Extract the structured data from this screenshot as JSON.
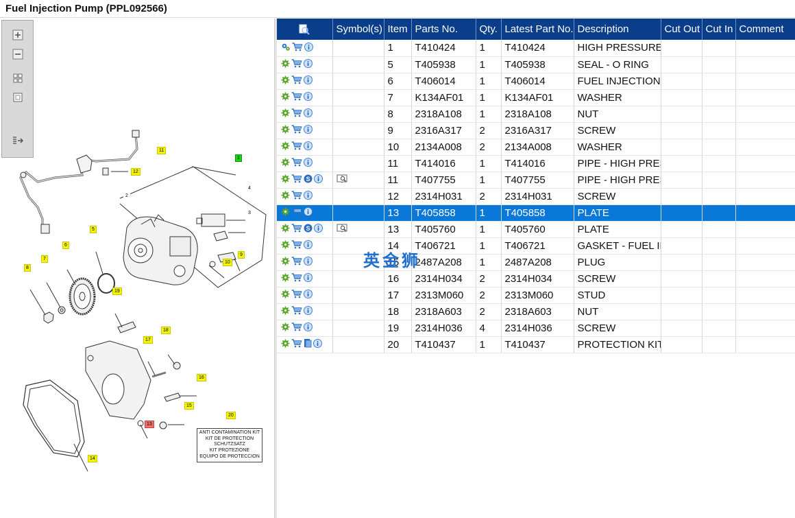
{
  "window": {
    "title": "Fuel Injection Pump (PPL092566)"
  },
  "toolbox": {
    "zoom_in": "zoom-in-icon",
    "zoom_out": "zoom-out-icon",
    "fit_all": "fit-all-icon",
    "fit_page": "fit-page-icon",
    "export": "export-icon"
  },
  "diagram": {
    "callouts": [
      "1",
      "2",
      "3",
      "4",
      "5",
      "6",
      "7",
      "8",
      "9",
      "10",
      "11",
      "12",
      "13",
      "14",
      "15",
      "16",
      "17",
      "18",
      "19",
      "20"
    ],
    "kit_box_lines": [
      "ANTI CONTAMINATION KIT",
      "KIT DE PROTECTION",
      "SCHUTZSATZ",
      "KIT PROTEZIONE",
      "EQUIPO DE PROTECCION"
    ]
  },
  "table": {
    "columns": [
      "",
      "Symbol(s)",
      "Item",
      "Parts No.",
      "Qty.",
      "Latest Part No.",
      "Description",
      "Cut Out",
      "Cut In",
      "Comment"
    ],
    "rows": [
      {
        "item": "1",
        "part": "T410424",
        "qty": "1",
        "latest": "T410424",
        "desc": "HIGH PRESSURE FUEL PUMP",
        "icons": [
          "gears-icon",
          "cart-icon",
          "info-icon"
        ],
        "symbols": ""
      },
      {
        "item": "5",
        "part": "T405938",
        "qty": "1",
        "latest": "T405938",
        "desc": "SEAL - O RING",
        "icons": [
          "gear-icon",
          "cart-icon",
          "info-icon"
        ],
        "symbols": ""
      },
      {
        "item": "6",
        "part": "T406014",
        "qty": "1",
        "latest": "T406014",
        "desc": "FUEL INJECTION PUMP GEAR",
        "icons": [
          "gear-icon",
          "cart-icon",
          "info-icon"
        ],
        "symbols": ""
      },
      {
        "item": "7",
        "part": "K134AF01",
        "qty": "1",
        "latest": "K134AF01",
        "desc": "WASHER",
        "icons": [
          "gear-icon",
          "cart-icon",
          "info-icon"
        ],
        "symbols": ""
      },
      {
        "item": "8",
        "part": "2318A108",
        "qty": "1",
        "latest": "2318A108",
        "desc": "NUT",
        "icons": [
          "gear-icon",
          "cart-icon",
          "info-icon"
        ],
        "symbols": ""
      },
      {
        "item": "9",
        "part": "2316A317",
        "qty": "2",
        "latest": "2316A317",
        "desc": "SCREW",
        "icons": [
          "gear-icon",
          "cart-icon",
          "info-icon"
        ],
        "symbols": ""
      },
      {
        "item": "10",
        "part": "2134A008",
        "qty": "2",
        "latest": "2134A008",
        "desc": "WASHER",
        "icons": [
          "gear-icon",
          "cart-icon",
          "info-icon"
        ],
        "symbols": ""
      },
      {
        "item": "11",
        "part": "T414016",
        "qty": "1",
        "latest": "T414016",
        "desc": "PIPE - HIGH PRESSURE",
        "icons": [
          "gear-icon",
          "cart-icon",
          "info-icon"
        ],
        "symbols": ""
      },
      {
        "item": "11",
        "part": "T407755",
        "qty": "1",
        "latest": "T407755",
        "desc": "PIPE - HIGH PRESSURE",
        "icons": [
          "gear-icon",
          "cart-icon",
          "s-badge-icon",
          "info-icon"
        ],
        "symbols": "book-icon"
      },
      {
        "item": "12",
        "part": "2314H031",
        "qty": "2",
        "latest": "2314H031",
        "desc": "SCREW",
        "icons": [
          "gear-icon",
          "cart-icon",
          "info-icon"
        ],
        "symbols": ""
      },
      {
        "item": "13",
        "part": "T405858",
        "qty": "1",
        "latest": "T405858",
        "desc": "PLATE",
        "icons": [
          "gear-icon",
          "cart-icon",
          "info-icon"
        ],
        "symbols": "",
        "selected": true
      },
      {
        "item": "13",
        "part": "T405760",
        "qty": "1",
        "latest": "T405760",
        "desc": "PLATE",
        "icons": [
          "gear-icon",
          "cart-icon",
          "s-badge-icon",
          "info-icon"
        ],
        "symbols": "book-icon"
      },
      {
        "item": "14",
        "part": "T406721",
        "qty": "1",
        "latest": "T406721",
        "desc": "GASKET - FUEL INJECTION PUMP",
        "icons": [
          "gear-icon",
          "cart-icon",
          "info-icon"
        ],
        "symbols": ""
      },
      {
        "item": "15",
        "part": "2487A208",
        "qty": "1",
        "latest": "2487A208",
        "desc": "PLUG",
        "icons": [
          "gear-icon",
          "cart-icon",
          "info-icon"
        ],
        "symbols": ""
      },
      {
        "item": "16",
        "part": "2314H034",
        "qty": "2",
        "latest": "2314H034",
        "desc": "SCREW",
        "icons": [
          "gear-icon",
          "cart-icon",
          "info-icon"
        ],
        "symbols": ""
      },
      {
        "item": "17",
        "part": "2313M060",
        "qty": "2",
        "latest": "2313M060",
        "desc": "STUD",
        "icons": [
          "gear-icon",
          "cart-icon",
          "info-icon"
        ],
        "symbols": ""
      },
      {
        "item": "18",
        "part": "2318A603",
        "qty": "2",
        "latest": "2318A603",
        "desc": "NUT",
        "icons": [
          "gear-icon",
          "cart-icon",
          "info-icon"
        ],
        "symbols": ""
      },
      {
        "item": "19",
        "part": "2314H036",
        "qty": "4",
        "latest": "2314H036",
        "desc": "SCREW",
        "icons": [
          "gear-icon",
          "cart-icon",
          "info-icon"
        ],
        "symbols": ""
      },
      {
        "item": "20",
        "part": "T410437",
        "qty": "1",
        "latest": "T410437",
        "desc": "PROTECTION KIT",
        "icons": [
          "gear-icon",
          "cart-icon",
          "document-icon",
          "info-icon"
        ],
        "symbols": ""
      }
    ]
  },
  "watermark": "英金狮",
  "colors": {
    "header_bg": "#0a3e8a",
    "selected_row": "#0a78d6",
    "gear_green": "#5aa52a",
    "cart_blue": "#2e6fb8",
    "info_blue": "#3a82d6",
    "callout_yellow": "#f5f500"
  }
}
